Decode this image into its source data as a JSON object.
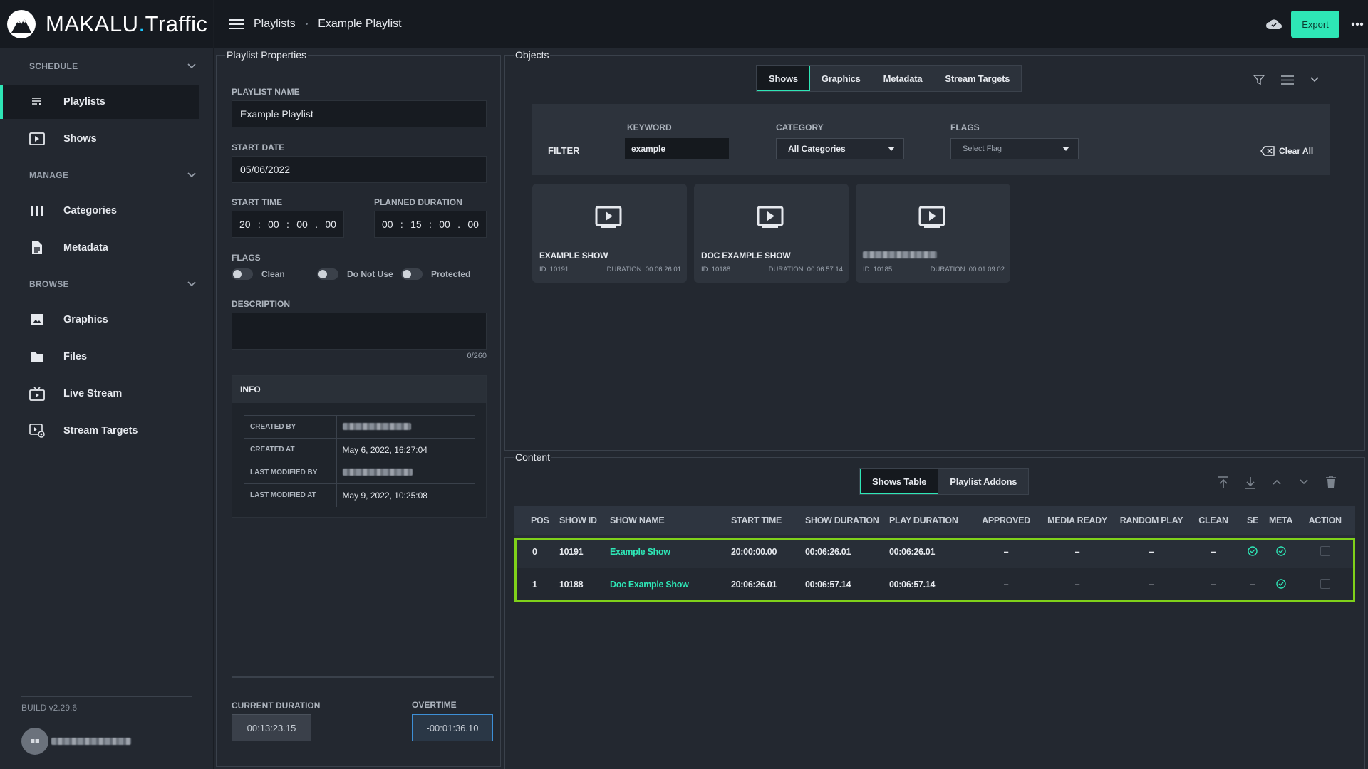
{
  "app": {
    "logo_text_main": "MAKALU",
    "logo_text_dot": ".",
    "logo_text_suffix": "Traffic",
    "build": "BUILD v2.29.6"
  },
  "colors": {
    "accent": "#2ee6b6",
    "highlight": "#7fd11a",
    "background": "#232830",
    "header": "#161a20"
  },
  "sidebar": {
    "sections": [
      {
        "label": "SCHEDULE",
        "items": [
          {
            "label": "Playlists",
            "icon": "playlist-icon",
            "active": true
          },
          {
            "label": "Shows",
            "icon": "play-screen-icon"
          }
        ]
      },
      {
        "label": "MANAGE",
        "items": [
          {
            "label": "Categories",
            "icon": "columns-icon"
          },
          {
            "label": "Metadata",
            "icon": "document-icon"
          }
        ]
      },
      {
        "label": "BROWSE",
        "items": [
          {
            "label": "Graphics",
            "icon": "image-icon"
          },
          {
            "label": "Files",
            "icon": "folder-icon"
          },
          {
            "label": "Live Stream",
            "icon": "tv-icon"
          },
          {
            "label": "Stream Targets",
            "icon": "target-screen-icon"
          }
        ]
      }
    ]
  },
  "header": {
    "breadcrumb": [
      "Playlists",
      "Example Playlist"
    ],
    "export_label": "Export"
  },
  "properties": {
    "title": "Playlist Properties",
    "name_label": "PLAYLIST NAME",
    "name_value": "Example Playlist",
    "start_date_label": "START DATE",
    "start_date_value": "05/06/2022",
    "start_time_label": "START TIME",
    "start_time": [
      "20",
      "00",
      "00",
      "00"
    ],
    "planned_duration_label": "PLANNED DURATION",
    "planned_duration": [
      "00",
      "15",
      "00",
      "00"
    ],
    "flags_label": "FLAGS",
    "flags": [
      "Clean",
      "Do Not Use",
      "Protected"
    ],
    "description_label": "DESCRIPTION",
    "description_value": "",
    "description_counter": "0/260",
    "info": {
      "title": "INFO",
      "rows": [
        {
          "key": "CREATED BY",
          "value": ""
        },
        {
          "key": "CREATED AT",
          "value": "May 6, 2022, 16:27:04"
        },
        {
          "key": "LAST MODIFIED BY",
          "value": ""
        },
        {
          "key": "LAST MODIFIED AT",
          "value": "May 9, 2022, 10:25:08"
        }
      ]
    },
    "current_duration_label": "CURRENT DURATION",
    "current_duration": "00:13:23.15",
    "overtime_label": "OVERTIME",
    "overtime": "-00:01:36.10"
  },
  "objects": {
    "title": "Objects",
    "tabs": [
      "Shows",
      "Graphics",
      "Metadata",
      "Stream Targets"
    ],
    "filter": {
      "label": "FILTER",
      "keyword_label": "KEYWORD",
      "keyword_value": "example",
      "category_label": "CATEGORY",
      "category_value": "All Categories",
      "flags_label": "FLAGS",
      "flags_placeholder": "Select Flag",
      "clear_label": "Clear All"
    },
    "cards": [
      {
        "name": "EXAMPLE SHOW",
        "id": "ID: 10191",
        "duration": "DURATION: 00:06:26.01"
      },
      {
        "name": "DOC EXAMPLE SHOW",
        "id": "ID: 10188",
        "duration": "DURATION: 00:06:57.14"
      },
      {
        "name": "",
        "id": "ID: 10185",
        "duration": "DURATION: 00:01:09.02"
      }
    ]
  },
  "content": {
    "title": "Content",
    "tabs": [
      "Shows Table",
      "Playlist Addons"
    ],
    "columns": [
      "POS",
      "SHOW ID",
      "SHOW NAME",
      "START TIME",
      "SHOW DURATION",
      "PLAY DURATION",
      "APPROVED",
      "MEDIA READY",
      "RANDOM PLAY",
      "CLEAN",
      "SE",
      "META",
      "ACTION"
    ],
    "rows": [
      {
        "pos": "0",
        "id": "10191",
        "name": "Example Show",
        "start": "20:00:00.00",
        "show_dur": "00:06:26.01",
        "play_dur": "00:06:26.01",
        "approved": "–",
        "media_ready": "–",
        "random_play": "–",
        "clean": "–",
        "se": "check",
        "meta": "check"
      },
      {
        "pos": "1",
        "id": "10188",
        "name": "Doc Example Show",
        "start": "20:06:26.01",
        "show_dur": "00:06:57.14",
        "play_dur": "00:06:57.14",
        "approved": "–",
        "media_ready": "–",
        "random_play": "–",
        "clean": "–",
        "se": "–",
        "meta": "check"
      }
    ]
  }
}
